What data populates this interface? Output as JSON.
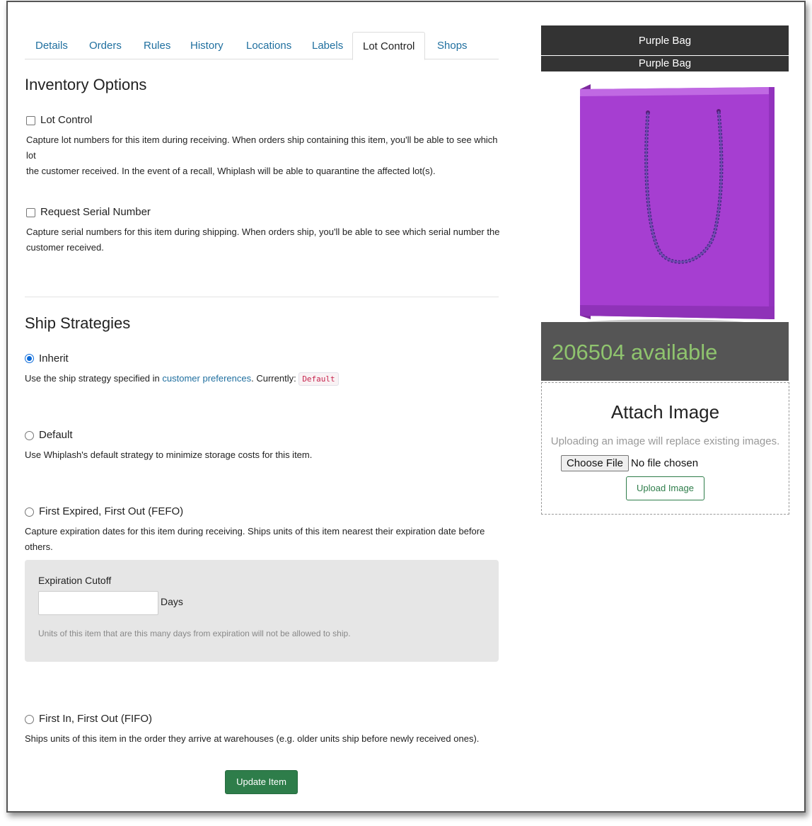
{
  "tabs": [
    {
      "label": "Details"
    },
    {
      "label": "Orders"
    },
    {
      "label": "Rules"
    },
    {
      "label": "History"
    },
    {
      "label": "Locations"
    },
    {
      "label": "Labels"
    },
    {
      "label": "Lot Control",
      "active": true
    },
    {
      "label": "Shops"
    }
  ],
  "inventory": {
    "heading": "Inventory Options",
    "lot_control": {
      "label": "Lot Control",
      "checked": false,
      "desc_line1": "Capture lot numbers for this item during receiving. When orders ship containing this item, you'll be able to see which lot",
      "desc_line2": "the customer received. In the event of a recall, Whiplash will be able to quarantine the affected lot(s)."
    },
    "serial": {
      "label": "Request Serial Number",
      "checked": false,
      "desc_line1": "Capture serial numbers for this item during shipping. When orders ship, you'll be able to see which serial number the",
      "desc_line2": "customer received."
    }
  },
  "ship": {
    "heading": "Ship Strategies",
    "inherit": {
      "label": "Inherit",
      "checked": true,
      "desc_prefix": "Use the ship strategy specified in ",
      "desc_link": "customer preferences",
      "desc_suffix": ". Currently: ",
      "current_value": "Default"
    },
    "default": {
      "label": "Default",
      "desc": "Use Whiplash's default strategy to minimize storage costs for this item."
    },
    "fefo": {
      "label": "First Expired, First Out (FEFO)",
      "desc_line1": "Capture expiration dates for this item during receiving. Ships units of this item nearest their expiration date before",
      "desc_line2": "others.",
      "cutoff_label": "Expiration Cutoff",
      "cutoff_value": "",
      "cutoff_unit": "Days",
      "cutoff_help": "Units of this item that are this many days from expiration will not be allowed to ship."
    },
    "fifo": {
      "label": "First In, First Out (FIFO)",
      "desc": "Ships units of this item in the order they arrive at warehouses (e.g. older units ship before newly received ones)."
    },
    "update_button": "Update Item"
  },
  "product": {
    "title_top": "Purple Bag",
    "title_bottom": "Purple Bag",
    "available": "206504 available",
    "image_color": "#a63ed1"
  },
  "attach": {
    "heading": "Attach Image",
    "hint": "Uploading an image will replace existing images.",
    "choose_file": "Choose File",
    "no_file": "No file chosen",
    "upload_button": "Upload Image"
  }
}
